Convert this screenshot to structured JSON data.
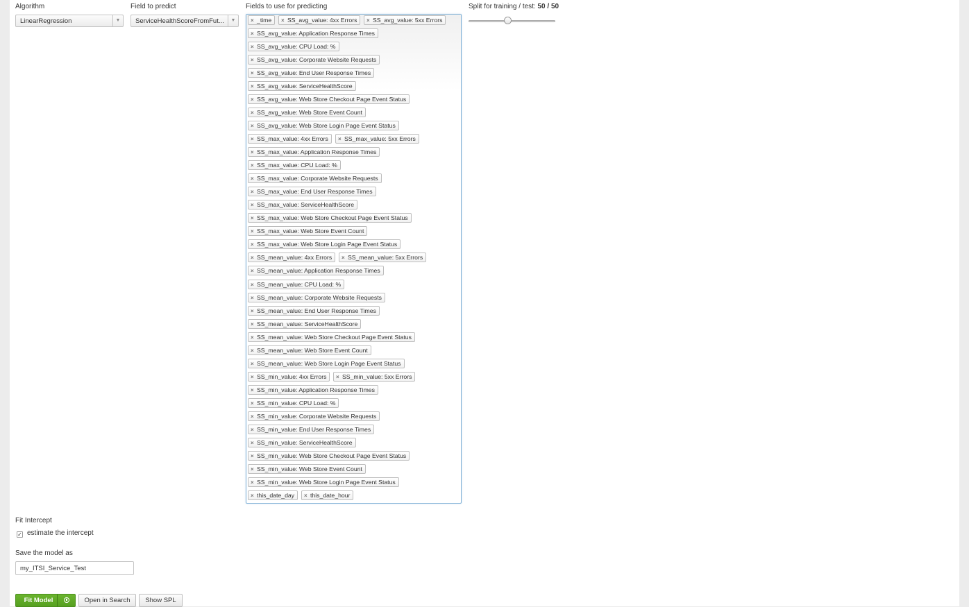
{
  "algorithm": {
    "label": "Algorithm",
    "value": "LinearRegression",
    "arrow": "▼"
  },
  "predict": {
    "label": "Field to predict",
    "value": "ServiceHealthScoreFromFut...",
    "arrow": "▼"
  },
  "fields": {
    "label": "Fields to use for predicting",
    "remove_glyph": "×",
    "chips": [
      "_time",
      "SS_avg_value: 4xx Errors",
      "SS_avg_value: 5xx Errors",
      "SS_avg_value: Application Response Times",
      "SS_avg_value: CPU Load: %",
      "SS_avg_value: Corporate Website Requests",
      "SS_avg_value: End User Response Times",
      "SS_avg_value: ServiceHealthScore",
      "SS_avg_value: Web Store Checkout Page Event Status",
      "SS_avg_value: Web Store Event Count",
      "SS_avg_value: Web Store Login Page Event Status",
      "SS_max_value: 4xx Errors",
      "SS_max_value: 5xx Errors",
      "SS_max_value: Application Response Times",
      "SS_max_value: CPU Load: %",
      "SS_max_value: Corporate Website Requests",
      "SS_max_value: End User Response Times",
      "SS_max_value: ServiceHealthScore",
      "SS_max_value: Web Store Checkout Page Event Status",
      "SS_max_value: Web Store Event Count",
      "SS_max_value: Web Store Login Page Event Status",
      "SS_mean_value: 4xx Errors",
      "SS_mean_value: 5xx Errors",
      "SS_mean_value: Application Response Times",
      "SS_mean_value: CPU Load: %",
      "SS_mean_value: Corporate Website Requests",
      "SS_mean_value: End User Response Times",
      "SS_mean_value: ServiceHealthScore",
      "SS_mean_value: Web Store Checkout Page Event Status",
      "SS_mean_value: Web Store Event Count",
      "SS_mean_value: Web Store Login Page Event Status",
      "SS_min_value: 4xx Errors",
      "SS_min_value: 5xx Errors",
      "SS_min_value: Application Response Times",
      "SS_min_value: CPU Load: %",
      "SS_min_value: Corporate Website Requests",
      "SS_min_value: End User Response Times",
      "SS_min_value: ServiceHealthScore",
      "SS_min_value: Web Store Checkout Page Event Status",
      "SS_min_value: Web Store Event Count",
      "SS_min_value: Web Store Login Page Event Status",
      "this_date_day",
      "this_date_hour"
    ]
  },
  "split": {
    "label": "Split for training / test:",
    "value": "50 / 50",
    "fraction": 0.5
  },
  "intercept": {
    "label": "Fit Intercept",
    "checkbox_label": "estimate the intercept",
    "checked": true,
    "check_glyph": "✓"
  },
  "save": {
    "label": "Save the model as",
    "value": "my_ITSI_Service_Test"
  },
  "actions": {
    "fit_label": "Fit Model",
    "open_search_label": "Open in Search",
    "show_spl_label": "Show SPL"
  },
  "icons": {
    "chip_remove": "close-icon",
    "dropdown": "caret-down-icon",
    "schedule": "clock-icon",
    "check": "checkmark-icon"
  },
  "colors": {
    "primary_button": "#5ca824",
    "multiselect_border": "#7eb0d6"
  }
}
